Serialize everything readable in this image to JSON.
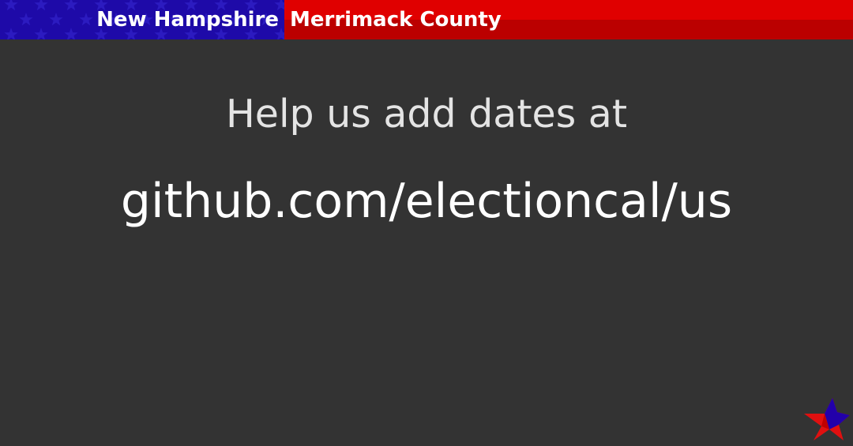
{
  "header": {
    "state": "New Hampshire",
    "county": "Merrimack County"
  },
  "message": {
    "help_text": "Help us add dates at",
    "url": "github.com/electioncal/us"
  },
  "icons": {
    "banner_pattern": "star-pattern-icon",
    "logo": "star-logo-icon"
  },
  "colors": {
    "background": "#333333",
    "state_bg": "#1e0aa8",
    "county_bg_top": "#e00000",
    "county_bg_bottom": "#bb0000",
    "text": "#ffffff",
    "logo_red": "#e01010",
    "logo_blue": "#2200aa"
  }
}
